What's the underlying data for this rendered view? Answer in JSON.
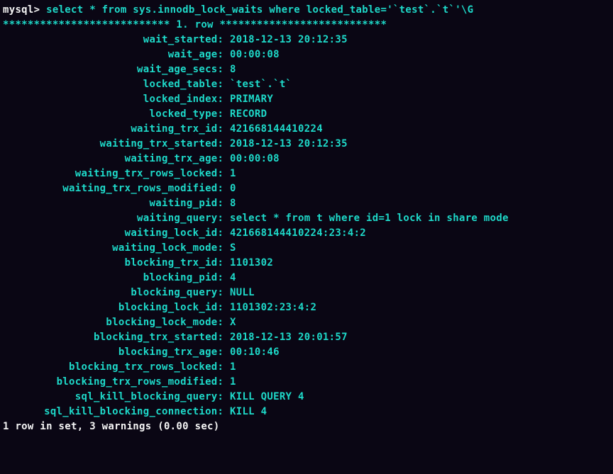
{
  "prompt": {
    "prefix": "mysql> ",
    "command": "select * from sys.innodb_lock_waits where locked_table='`test`.`t`'\\G"
  },
  "row_header": "*************************** 1. row ***************************",
  "fields": [
    {
      "label": "wait_started",
      "value": "2018-12-13 20:12:35"
    },
    {
      "label": "wait_age",
      "value": "00:00:08"
    },
    {
      "label": "wait_age_secs",
      "value": "8"
    },
    {
      "label": "locked_table",
      "value": "`test`.`t`"
    },
    {
      "label": "locked_index",
      "value": "PRIMARY"
    },
    {
      "label": "locked_type",
      "value": "RECORD"
    },
    {
      "label": "waiting_trx_id",
      "value": "421668144410224"
    },
    {
      "label": "waiting_trx_started",
      "value": "2018-12-13 20:12:35"
    },
    {
      "label": "waiting_trx_age",
      "value": "00:00:08"
    },
    {
      "label": "waiting_trx_rows_locked",
      "value": "1"
    },
    {
      "label": "waiting_trx_rows_modified",
      "value": "0"
    },
    {
      "label": "waiting_pid",
      "value": "8"
    },
    {
      "label": "waiting_query",
      "value": "select * from t where id=1 lock in share mode"
    },
    {
      "label": "waiting_lock_id",
      "value": "421668144410224:23:4:2"
    },
    {
      "label": "waiting_lock_mode",
      "value": "S"
    },
    {
      "label": "blocking_trx_id",
      "value": "1101302"
    },
    {
      "label": "blocking_pid",
      "value": "4"
    },
    {
      "label": "blocking_query",
      "value": "NULL"
    },
    {
      "label": "blocking_lock_id",
      "value": "1101302:23:4:2"
    },
    {
      "label": "blocking_lock_mode",
      "value": "X"
    },
    {
      "label": "blocking_trx_started",
      "value": "2018-12-13 20:01:57"
    },
    {
      "label": "blocking_trx_age",
      "value": "00:10:46"
    },
    {
      "label": "blocking_trx_rows_locked",
      "value": "1"
    },
    {
      "label": "blocking_trx_rows_modified",
      "value": "1"
    },
    {
      "label": "sql_kill_blocking_query",
      "value": "KILL QUERY 4"
    },
    {
      "label": "sql_kill_blocking_connection",
      "value": "KILL 4"
    }
  ],
  "footer": "1 row in set, 3 warnings (0.00 sec)"
}
